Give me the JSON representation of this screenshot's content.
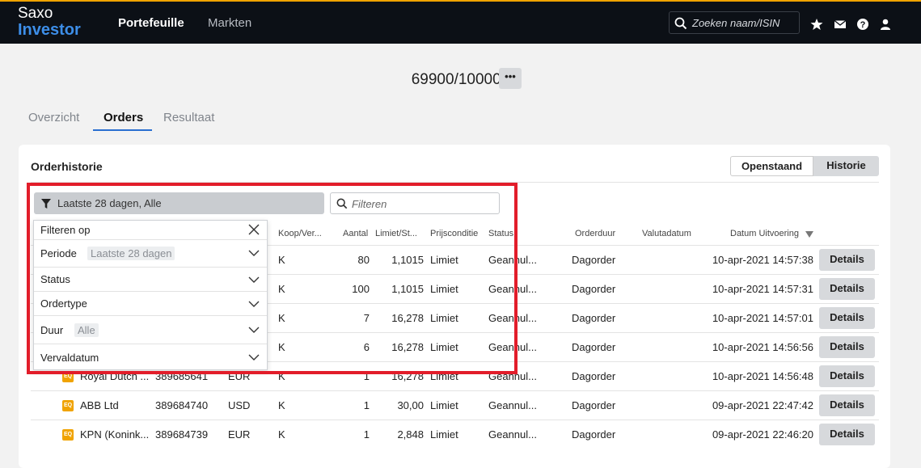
{
  "header": {
    "logo_line1": "Saxo",
    "logo_line2": "Investor",
    "nav": [
      "Portefeuille",
      "Markten"
    ],
    "search_placeholder": "Zoeken naam/ISIN",
    "icons": [
      "star-icon",
      "mail-icon",
      "help-icon",
      "user-icon"
    ]
  },
  "account": {
    "number": "69900/100001",
    "more_label": "•••"
  },
  "tabs": [
    "Overzicht",
    "Orders",
    "Resultaat"
  ],
  "panel": {
    "title": "Orderhistorie",
    "toggle": [
      "Openstaand",
      "Historie"
    ],
    "filter_summary": "Laatste 28 dagen, Alle",
    "filter_placeholder": "Filteren"
  },
  "columns": [
    "Koop/Ver...",
    "Aantal",
    "Limiet/St...",
    "Prijsconditie",
    "Status",
    "Orderduur",
    "Valutadatum",
    "Datum Uitvoering"
  ],
  "rows": [
    {
      "instrument": "",
      "id": "",
      "cur": "",
      "side": "K",
      "qty": "80",
      "limit": "1,1015",
      "cond": "Limiet",
      "status": "Geannul...",
      "dur": "Dagorder",
      "date": "10-apr-2021 14:57:38",
      "details": "Details"
    },
    {
      "instrument": "",
      "id": "",
      "cur": "",
      "side": "K",
      "qty": "100",
      "limit": "1,1015",
      "cond": "Limiet",
      "status": "Geannul...",
      "dur": "Dagorder",
      "date": "10-apr-2021 14:57:31",
      "details": "Details"
    },
    {
      "instrument": "",
      "id": "",
      "cur": "",
      "side": "K",
      "qty": "7",
      "limit": "16,278",
      "cond": "Limiet",
      "status": "Geannul...",
      "dur": "Dagorder",
      "date": "10-apr-2021 14:57:01",
      "details": "Details"
    },
    {
      "instrument": "",
      "id": "",
      "cur": "",
      "side": "K",
      "qty": "6",
      "limit": "16,278",
      "cond": "Limiet",
      "status": "Geannul...",
      "dur": "Dagorder",
      "date": "10-apr-2021 14:56:56",
      "details": "Details"
    },
    {
      "instrument": "Royal Dutch ...",
      "id": "389685641",
      "cur": "EUR",
      "side": "K",
      "qty": "1",
      "limit": "16,278",
      "cond": "Limiet",
      "status": "Geannul...",
      "dur": "Dagorder",
      "date": "10-apr-2021 14:56:48",
      "details": "Details"
    },
    {
      "instrument": "ABB Ltd",
      "id": "389684740",
      "cur": "USD",
      "side": "K",
      "qty": "1",
      "limit": "30,00",
      "cond": "Limiet",
      "status": "Geannul...",
      "dur": "Dagorder",
      "date": "09-apr-2021 22:47:42",
      "details": "Details"
    },
    {
      "instrument": "KPN (Konink...",
      "id": "389684739",
      "cur": "EUR",
      "side": "K",
      "qty": "1",
      "limit": "2,848",
      "cond": "Limiet",
      "status": "Geannul...",
      "dur": "Dagorder",
      "date": "09-apr-2021 22:46:20",
      "details": "Details"
    }
  ],
  "eq_badge": "EQ",
  "filter_dropdown": {
    "title": "Filteren op",
    "items": [
      {
        "label": "Periode",
        "value": "Laatste 28 dagen"
      },
      {
        "label": "Status",
        "value": ""
      },
      {
        "label": "Ordertype",
        "value": ""
      },
      {
        "label": "Duur",
        "value": "Alle"
      },
      {
        "label": "Vervaldatum",
        "value": ""
      }
    ]
  },
  "colors": {
    "accent": "#2a6fd0",
    "brand_blue": "#3d8ee8",
    "highlight": "#e21d2a",
    "topbar": "#0c1016",
    "orange": "#f0a300"
  }
}
